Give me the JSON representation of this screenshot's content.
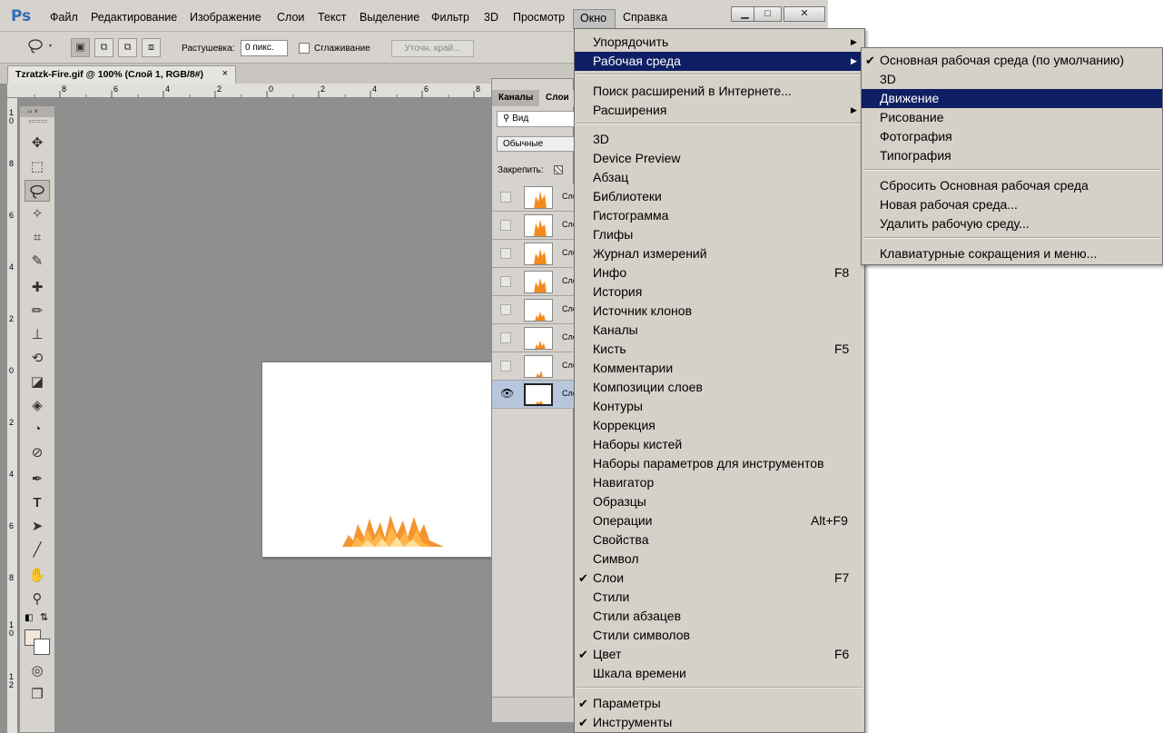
{
  "app": {
    "logo": "Ps",
    "menu": [
      "Файл",
      "Редактирование",
      "Изображение",
      "Слои",
      "Текст",
      "Выделение",
      "Фильтр",
      "3D",
      "Просмотр",
      "Окно",
      "Справка"
    ],
    "window_buttons": [
      "▁",
      "□",
      "✕"
    ]
  },
  "options_bar": {
    "feather_label": "Растушевка:",
    "feather_value": "0 пикс.",
    "antialias_label": "Сглаживание",
    "refine_edge_label": "Уточн. край..."
  },
  "document_tab": {
    "title": "Tzratzk-Fire.gif @ 100% (Слой 1, RGB/8#)",
    "close": "×"
  },
  "ruler_top_labels": [
    "8",
    "6",
    "4",
    "2",
    "0",
    "2",
    "4",
    "6",
    "8"
  ],
  "ruler_left_labels": [
    "1\n0",
    "8",
    "6",
    "4",
    "2",
    "0",
    "2",
    "4",
    "6",
    "8",
    "1\n0",
    "1\n2"
  ],
  "tools_header": "›› ×",
  "layers_panel": {
    "tabs": [
      "Каналы",
      "Слои"
    ],
    "search_label": "Вид",
    "blend_mode": "Обычные",
    "lock_label": "Закрепить:",
    "layers": [
      {
        "name": "Сло",
        "visible": false,
        "active": false
      },
      {
        "name": "Сло",
        "visible": false,
        "active": false
      },
      {
        "name": "Сло",
        "visible": false,
        "active": false
      },
      {
        "name": "Сло",
        "visible": false,
        "active": false
      },
      {
        "name": "Сло",
        "visible": false,
        "active": false
      },
      {
        "name": "Сло",
        "visible": false,
        "active": false
      },
      {
        "name": "Сло",
        "visible": false,
        "active": false
      },
      {
        "name": "Сло",
        "visible": true,
        "active": true
      }
    ]
  },
  "window_menu": {
    "items": [
      {
        "label": "Упорядочить",
        "submenu": true
      },
      {
        "label": "Рабочая среда",
        "submenu": true,
        "highlighted": true
      },
      {
        "separator": true
      },
      {
        "label": "Поиск расширений в Интернете..."
      },
      {
        "label": "Расширения",
        "submenu": true
      },
      {
        "separator": true
      },
      {
        "label": "3D"
      },
      {
        "label": "Device Preview"
      },
      {
        "label": "Абзац"
      },
      {
        "label": "Библиотеки"
      },
      {
        "label": "Гистограмма"
      },
      {
        "label": "Глифы"
      },
      {
        "label": "Журнал измерений"
      },
      {
        "label": "Инфо",
        "shortcut": "F8"
      },
      {
        "label": "История"
      },
      {
        "label": "Источник клонов"
      },
      {
        "label": "Каналы"
      },
      {
        "label": "Кисть",
        "shortcut": "F5"
      },
      {
        "label": "Комментарии"
      },
      {
        "label": "Композиции слоев"
      },
      {
        "label": "Контуры"
      },
      {
        "label": "Коррекция"
      },
      {
        "label": "Наборы кистей"
      },
      {
        "label": "Наборы параметров для инструментов"
      },
      {
        "label": "Навигатор"
      },
      {
        "label": "Образцы"
      },
      {
        "label": "Операции",
        "shortcut": "Alt+F9"
      },
      {
        "label": "Свойства"
      },
      {
        "label": "Символ"
      },
      {
        "label": "Слои",
        "shortcut": "F7",
        "checked": true
      },
      {
        "label": "Стили"
      },
      {
        "label": "Стили абзацев"
      },
      {
        "label": "Стили символов"
      },
      {
        "label": "Цвет",
        "shortcut": "F6",
        "checked": true
      },
      {
        "label": "Шкала времени"
      },
      {
        "separator": true
      },
      {
        "label": "Параметры",
        "checked": true
      },
      {
        "label": "Инструменты",
        "checked": true
      }
    ]
  },
  "workspace_menu": {
    "items": [
      {
        "label": "Основная рабочая среда (по умолчанию)",
        "checked": true
      },
      {
        "label": "3D"
      },
      {
        "label": "Движение",
        "highlighted": true
      },
      {
        "label": "Рисование"
      },
      {
        "label": "Фотография"
      },
      {
        "label": "Типография"
      },
      {
        "separator": true
      },
      {
        "label": "Сбросить Основная рабочая среда"
      },
      {
        "label": "Новая рабочая среда..."
      },
      {
        "label": "Удалить рабочую среду..."
      },
      {
        "separator": true
      },
      {
        "label": "Клавиатурные сокращения и меню..."
      }
    ]
  },
  "colors": {
    "menu_highlight": "#0f1f63",
    "menu_bg": "#d5d1c9",
    "workspace_bg": "#8f8f8f",
    "fire_orange": "#f48a1a",
    "foreground_swatch": "#f3e8d8"
  }
}
